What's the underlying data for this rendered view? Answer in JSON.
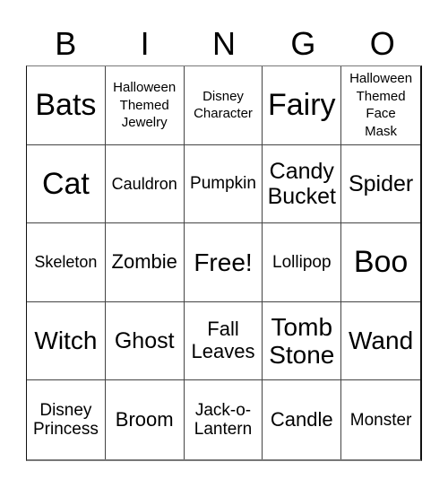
{
  "header": {
    "letters": [
      "B",
      "I",
      "N",
      "G",
      "O"
    ]
  },
  "board": {
    "rows": [
      [
        "Bats",
        "Halloween Themed Jewelry",
        "Disney Character",
        "Fairy",
        "Halloween Themed Face Mask"
      ],
      [
        "Cat",
        "Cauldron",
        "Pumpkin",
        "Candy Bucket",
        "Spider"
      ],
      [
        "Skeleton",
        "Zombie",
        "Free!",
        "Lollipop",
        "Boo"
      ],
      [
        "Witch",
        "Ghost",
        "Fall Leaves",
        "Tomb Stone",
        "Wand"
      ],
      [
        "Disney Princess",
        "Broom",
        "Jack-o-Lantern",
        "Candle",
        "Monster"
      ]
    ],
    "cells": {
      "r0c0": "Bats",
      "r0c1": "Halloween\nThemed\nJewelry",
      "r0c2": "Disney\nCharacter",
      "r0c3": "Fairy",
      "r0c4": "Halloween\nThemed\nFace\nMask",
      "r1c0": "Cat",
      "r1c1": "Cauldron",
      "r1c2": "Pumpkin",
      "r1c3": "Candy\nBucket",
      "r1c4": "Spider",
      "r2c0": "Skeleton",
      "r2c1": "Zombie",
      "r2c2": "Free!",
      "r2c3": "Lollipop",
      "r2c4": "Boo",
      "r3c0": "Witch",
      "r3c1": "Ghost",
      "r3c2": "Fall\nLeaves",
      "r3c3": "Tomb\nStone",
      "r3c4": "Wand",
      "r4c0": "Disney\nPrincess",
      "r4c1": "Broom",
      "r4c2": "Jack-o-\nLantern",
      "r4c3": "Candle",
      "r4c4": "Monster"
    },
    "free_space": "Free!"
  }
}
